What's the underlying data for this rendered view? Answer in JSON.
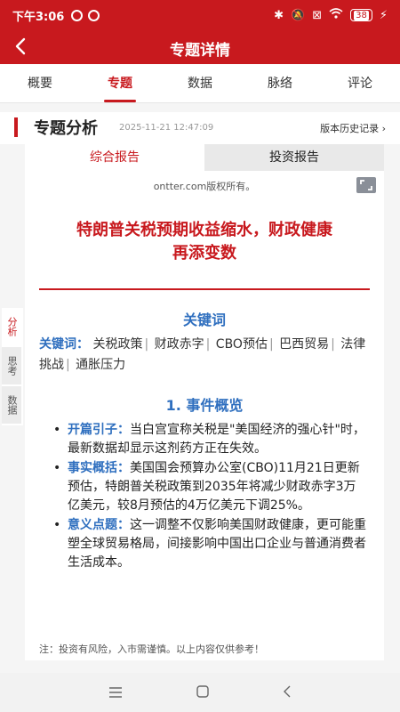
{
  "status": {
    "time": "下午3:06",
    "battery": "38"
  },
  "header": {
    "title": "专题详情"
  },
  "tabs": [
    {
      "label": "概要"
    },
    {
      "label": "专题"
    },
    {
      "label": "数据"
    },
    {
      "label": "脉络"
    },
    {
      "label": "评论"
    }
  ],
  "section": {
    "title": "专题分析",
    "timestamp": "2025-11-21 12:47:09",
    "history_label": "版本历史记录"
  },
  "side_tabs": [
    {
      "label": "分析"
    },
    {
      "label": "思考"
    },
    {
      "label": "数据"
    }
  ],
  "report": {
    "tabs": [
      {
        "label": "综合报告"
      },
      {
        "label": "投资报告"
      }
    ],
    "copyright": "ontter.com版权所有。",
    "headline_line1": "特朗普关税预期收益缩水，财政健康",
    "headline_line2": "再添变数",
    "keywords_title": "关键词",
    "keywords_label": "关键词：",
    "keywords": [
      "关税政策",
      "财政赤字",
      "CBO预估",
      "巴西贸易",
      "法律挑战",
      "通胀压力"
    ],
    "event_title": "1. 事件概览",
    "bullets": [
      {
        "label": "开篇引子：",
        "text": "当白宫宣称关税是\"美国经济的强心针\"时，最新数据却显示这剂药方正在失效。"
      },
      {
        "label": "事实概括：",
        "text": "美国国会预算办公室(CBO)11月21日更新预估，特朗普关税政策到2035年将减少财政赤字3万亿美元，较8月预估的4万亿美元下调25%。"
      },
      {
        "label": "意义点题：",
        "text": "这一调整不仅影响美国财政健康，更可能重塑全球贸易格局，间接影响中国出口企业与普通消费者生活成本。"
      }
    ],
    "note": "注：投资有风险，入市需谨慎。以上内容仅供参考！"
  },
  "colors": {
    "brand_red": "#c8191e",
    "keyword_blue": "#2f6fbf"
  }
}
